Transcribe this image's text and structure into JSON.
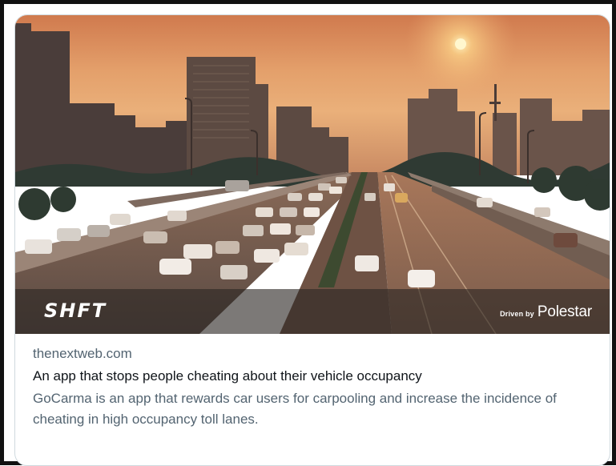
{
  "card": {
    "domain": "thenextweb.com",
    "title": "An app that stops people cheating about their vehicle occupancy",
    "description": "GoCarma is an app that rewards car users for carpooling and increase the incidence of cheating in high occupancy toll lanes."
  },
  "image": {
    "brand_logo": "SHFT",
    "sponsor_prefix": "Driven by",
    "sponsor_name": "Polestar"
  },
  "colors": {
    "border": "#cfd9de",
    "secondary_text": "#536471",
    "primary_text": "#0f1419",
    "sky_top": "#d98a57",
    "sun": "#fff4c4"
  }
}
